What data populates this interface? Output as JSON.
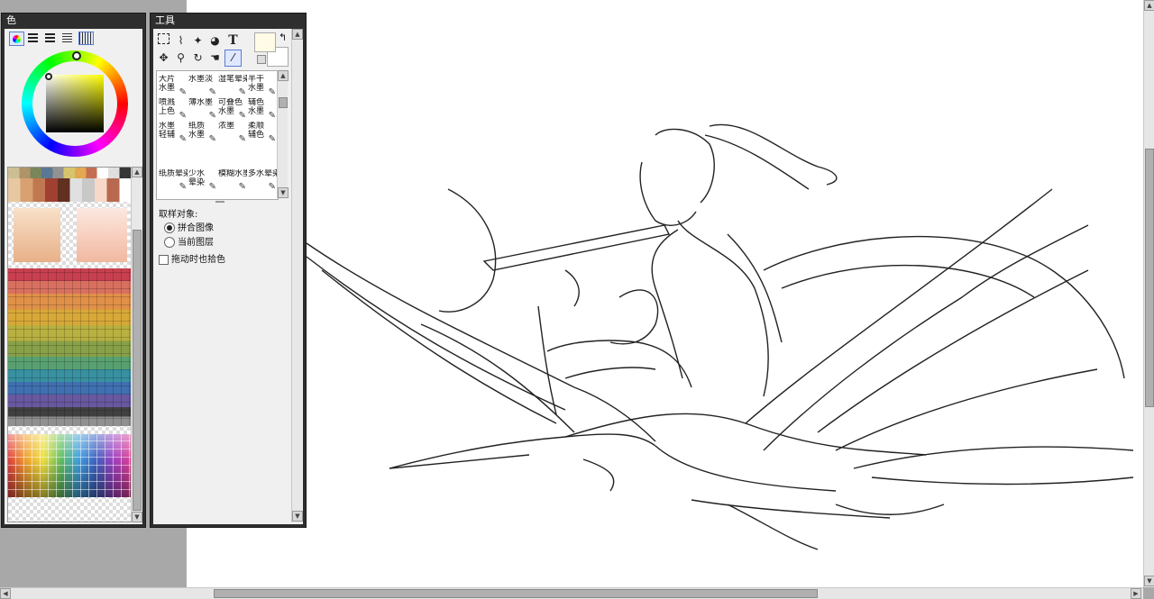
{
  "color_panel": {
    "title": "色",
    "tabs": [
      "color-wheel",
      "rgb-sliders",
      "hsv-sliders",
      "swatches",
      "palette"
    ]
  },
  "tool_panel": {
    "title": "工具",
    "tools_row1": [
      "select-rect",
      "lasso",
      "magic-wand",
      "fill",
      "text"
    ],
    "tools_row2": [
      "move",
      "zoom",
      "rotate",
      "hand",
      "eyedropper"
    ],
    "text_tool_glyph": "T",
    "brushes": [
      {
        "label": "大片\n水墨"
      },
      {
        "label": "水墨淡"
      },
      {
        "label": "湿笔晕染"
      },
      {
        "label": "半干\n水墨"
      },
      {
        "label": "喷溅\n上色"
      },
      {
        "label": "薄水墨"
      },
      {
        "label": "可叠色\n水墨"
      },
      {
        "label": "辅色\n水墨"
      },
      {
        "label": "水墨\n轻辅"
      },
      {
        "label": "纸质\n水墨"
      },
      {
        "label": "浓墨"
      },
      {
        "label": "柔顺\n辅色"
      },
      {
        "label": "纸质晕染"
      },
      {
        "label": "少水\n晕染"
      },
      {
        "label": "模糊水墨"
      },
      {
        "label": "多水晕染"
      }
    ],
    "sample_target_label": "取样对象:",
    "options": [
      {
        "label": "拼合图像",
        "checked": true
      },
      {
        "label": "当前图层",
        "checked": false
      }
    ],
    "drag_sample_label": "拖动时也拾色",
    "drag_sample_checked": false,
    "fg_color": "#fffbe6",
    "bg_color": "#ffffff"
  },
  "colors": {
    "panel_frame": "#2e2e2e",
    "wheel_indicator": "#ffff00"
  }
}
